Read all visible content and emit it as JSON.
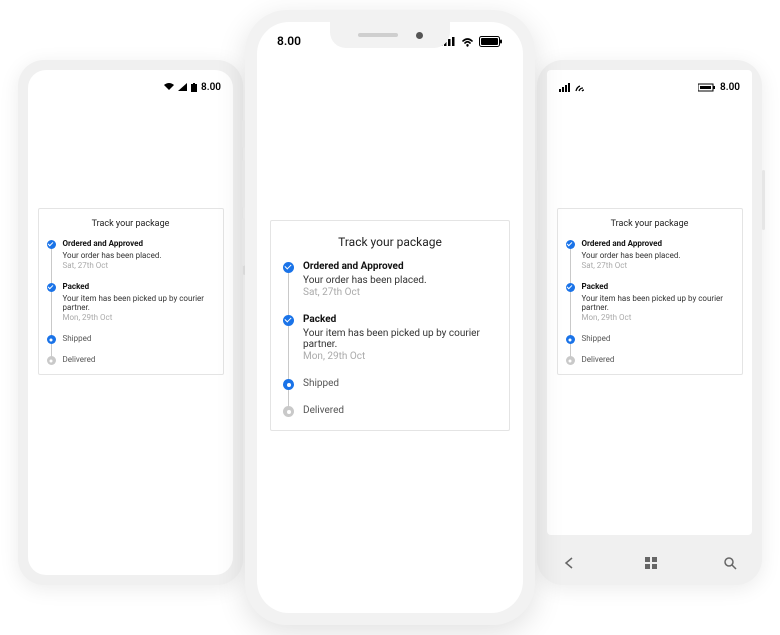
{
  "status": {
    "time": "8.00"
  },
  "card": {
    "title": "Track your package",
    "steps": [
      {
        "status": "done",
        "title": "Ordered and Approved",
        "desc": "Your order has been placed.",
        "date": "Sat, 27th Oct"
      },
      {
        "status": "done",
        "title": "Packed",
        "desc": "Your item has been picked up by courier partner.",
        "date": "Mon, 29th Oct"
      },
      {
        "status": "current",
        "title": "Shipped"
      },
      {
        "status": "pending",
        "title": "Delivered"
      }
    ]
  }
}
